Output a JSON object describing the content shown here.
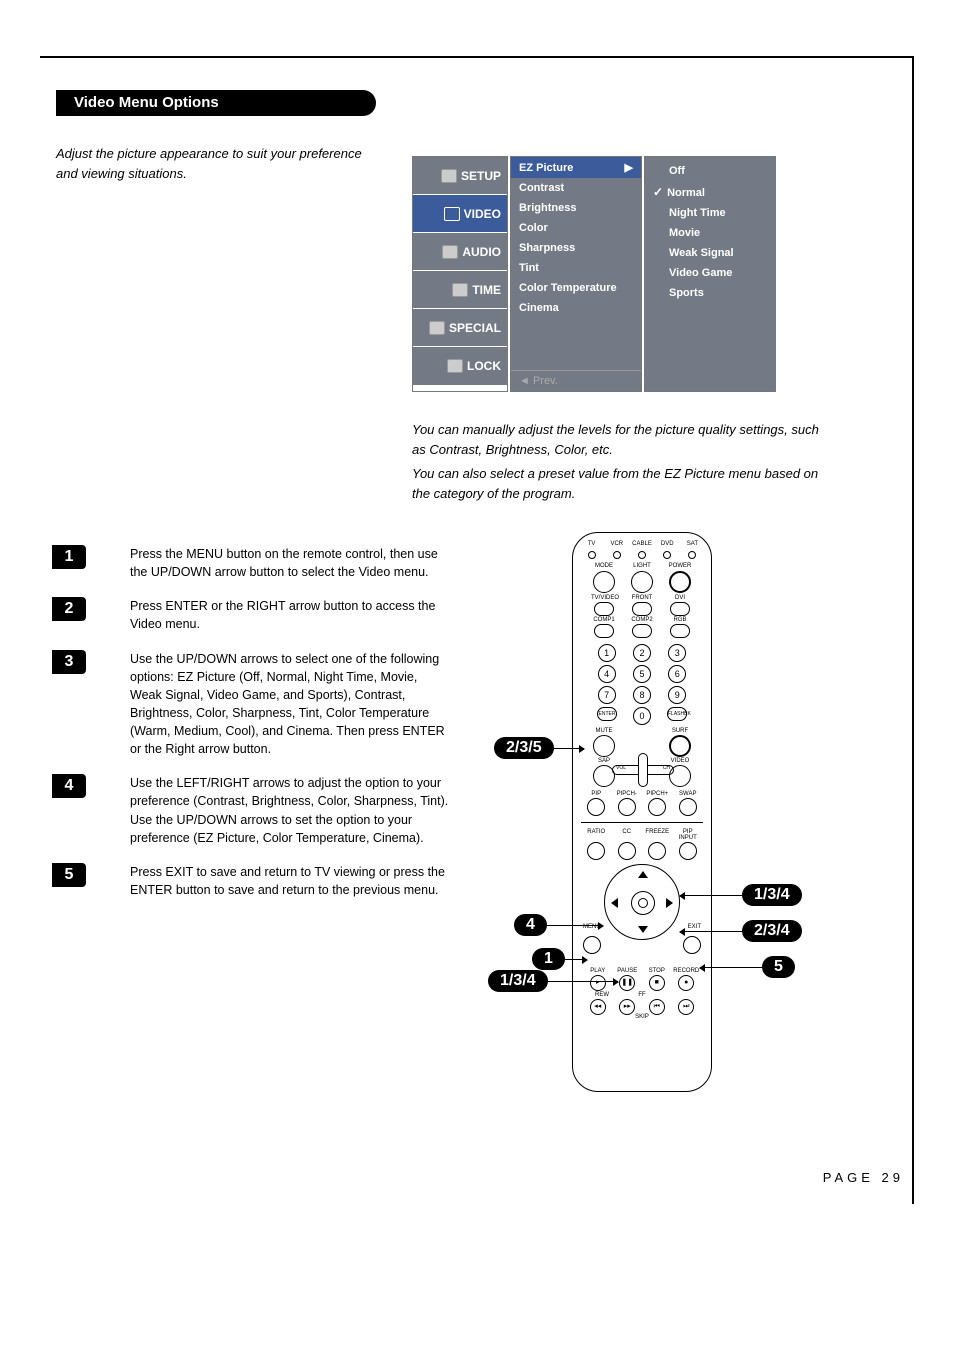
{
  "header": "Video Menu Options",
  "intro": "Adjust the picture appearance to suit your preference and viewing situations.",
  "osd": {
    "categories": [
      "SETUP",
      "VIDEO",
      "AUDIO",
      "TIME",
      "SPECIAL",
      "LOCK"
    ],
    "options": [
      "EZ Picture",
      "Contrast",
      "Brightness",
      "Color",
      "Sharpness",
      "Tint",
      "Color Temperature",
      "Cinema"
    ],
    "selected_option": "EZ Picture",
    "presets": [
      "Off",
      "Normal",
      "Night Time",
      "Movie",
      "Weak Signal",
      "Video Game",
      "Sports"
    ],
    "selected_preset": "Normal",
    "prev": "◄ Prev."
  },
  "body": {
    "p1": "You can manually adjust the levels for the picture quality settings, such as Contrast, Brightness, Color, etc.",
    "p2": "You can also select a preset value from the EZ Picture menu based on the category of the program."
  },
  "steps": [
    {
      "n": "1",
      "t": "Press the MENU button on the remote control, then use the UP/DOWN arrow button to select the Video menu."
    },
    {
      "n": "2",
      "t": "Press ENTER or the RIGHT arrow button to access the Video menu."
    },
    {
      "n": "3",
      "t": "Use the UP/DOWN arrows to select one of the following options: EZ Picture (Off, Normal, Night Time, Movie, Weak Signal, Video Game, and Sports), Contrast, Brightness, Color, Sharpness, Tint, Color Temperature (Warm, Medium, Cool), and Cinema. Then press ENTER or the Right arrow button."
    },
    {
      "n": "4",
      "t": "Use the LEFT/RIGHT arrows to adjust the option to your preference (Contrast, Brightness, Color, Sharpness, Tint). Use the UP/DOWN arrows to set the option to your preference (EZ Picture, Color Temperature, Cinema)."
    },
    {
      "n": "5",
      "t": "Press EXIT to save and return to TV viewing or press the ENTER button to save and return to the previous menu."
    }
  ],
  "remote": {
    "mode_row": [
      "TV",
      "VCR",
      "CABLE",
      "DVD",
      "SAT"
    ],
    "top_row": [
      "MODE",
      "LIGHT",
      "POWER"
    ],
    "inp_row1": [
      "TV/VIDEO",
      "FRONT",
      "DVI"
    ],
    "inp_row2": [
      "COMP1",
      "COMP2",
      "RGB"
    ],
    "nums": [
      "1",
      "2",
      "3",
      "4",
      "5",
      "6",
      "7",
      "8",
      "9",
      "0"
    ],
    "enter": "ENTER",
    "flashbk": "FLASHBK",
    "mute": "MUTE",
    "surf": "SURF",
    "sap": "SAP",
    "video": "VIDEO",
    "vol": "VOL",
    "ch": "CH",
    "pip_row": [
      "PIP",
      "PIPCH-",
      "PIPCH+",
      "SWAP"
    ],
    "opt_row": [
      "RATIO",
      "CC",
      "FREEZE",
      "PIP INPUT"
    ],
    "menu": "MENU",
    "exit": "EXIT",
    "transport1": [
      "PLAY",
      "PAUSE",
      "STOP",
      "RECORD"
    ],
    "transport2": [
      "REW",
      "FF"
    ],
    "skip": "SKIP"
  },
  "callouts": {
    "c235": "2/3/5",
    "c4": "4",
    "c1": "1",
    "c134l": "1/3/4",
    "c134r": "1/3/4",
    "c234": "2/3/4",
    "c5": "5"
  },
  "arrow": "▶",
  "page": "PAGE 29"
}
